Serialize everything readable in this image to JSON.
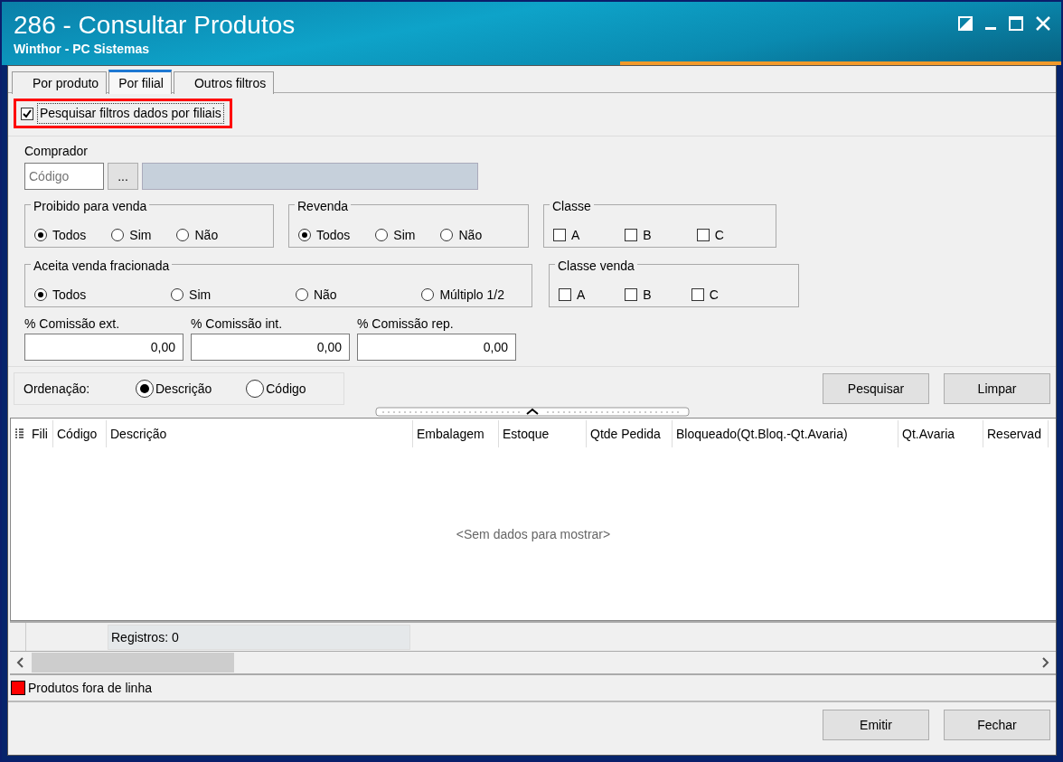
{
  "window": {
    "title": "286 - Consultar Produtos",
    "subtitle": "Winthor - PC Sistemas"
  },
  "tabs": [
    {
      "label": "Por produto",
      "selected": false
    },
    {
      "label": "Por filial",
      "selected": true
    },
    {
      "label": "Outros filtros",
      "selected": false
    }
  ],
  "filial_filter": {
    "label": "Pesquisar filtros dados por filiais",
    "checked": true
  },
  "comprador": {
    "label": "Comprador",
    "code_placeholder": "Código",
    "lookup_button": "..."
  },
  "group_rows": [
    [
      {
        "title": "Proibido para venda",
        "kind": "radio",
        "options": [
          {
            "label": "Todos",
            "selected": true
          },
          {
            "label": "Sim",
            "selected": false
          },
          {
            "label": "Não",
            "selected": false
          }
        ]
      },
      {
        "title": "Revenda",
        "kind": "radio",
        "options": [
          {
            "label": "Todos",
            "selected": true
          },
          {
            "label": "Sim",
            "selected": false
          },
          {
            "label": "Não",
            "selected": false
          }
        ]
      },
      {
        "title": "Classe",
        "kind": "check",
        "options": [
          {
            "label": "A",
            "checked": false
          },
          {
            "label": "B",
            "checked": false
          },
          {
            "label": "C",
            "checked": false
          }
        ]
      }
    ],
    [
      {
        "title": "Aceita venda fracionada",
        "kind": "radio",
        "options": [
          {
            "label": "Todos",
            "selected": true
          },
          {
            "label": "Sim",
            "selected": false
          },
          {
            "label": "Não",
            "selected": false
          },
          {
            "label": "Múltiplo 1/2",
            "selected": false
          }
        ]
      },
      {
        "title": "Classe venda",
        "kind": "check",
        "options": [
          {
            "label": "A",
            "checked": false
          },
          {
            "label": "B",
            "checked": false
          },
          {
            "label": "C",
            "checked": false
          }
        ]
      }
    ]
  ],
  "commissions": [
    {
      "label": "% Comissão ext.",
      "value": "0,00"
    },
    {
      "label": "% Comissão int.",
      "value": "0,00"
    },
    {
      "label": "% Comissão rep.",
      "value": "0,00"
    }
  ],
  "ordering": {
    "label": "Ordenação:",
    "options": [
      {
        "label": "Descrição",
        "selected": true
      },
      {
        "label": "Código",
        "selected": false
      }
    ]
  },
  "actions": [
    "Pesquisar",
    "Limpar"
  ],
  "grid": {
    "columns": [
      "Fili",
      "Código",
      "Descrição",
      "Embalagem",
      "Estoque",
      "Qtde Pedida",
      "Bloqueado(Qt.Bloq.-Qt.Avaria)",
      "Qt.Avaria",
      "Reservad"
    ],
    "empty_text": "<Sem dados para mostrar>",
    "footer": "Registros: 0"
  },
  "legend": {
    "label": "Produtos fora de linha",
    "color": "#ff0000"
  },
  "footer_buttons": [
    "Emitir",
    "Fechar"
  ]
}
